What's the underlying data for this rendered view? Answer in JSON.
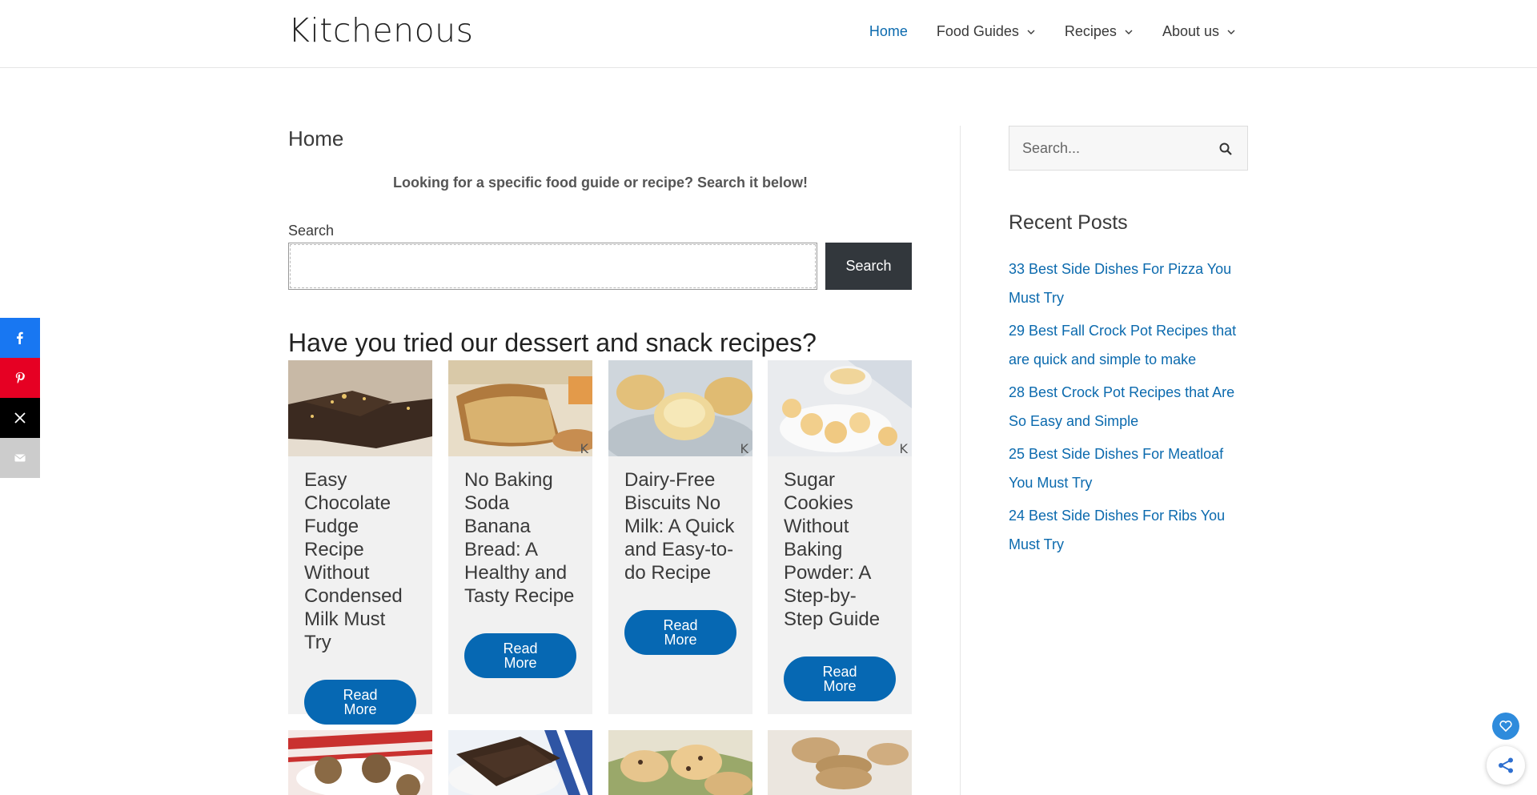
{
  "header": {
    "logo_text": "Kitchenous",
    "nav": [
      {
        "label": "Home",
        "active": true
      },
      {
        "label": "Food Guides",
        "active": false
      },
      {
        "label": "Recipes",
        "active": false
      },
      {
        "label": "About us",
        "active": false
      }
    ]
  },
  "social": [
    {
      "icon": "facebook-icon",
      "color": "#1877f2"
    },
    {
      "icon": "pinterest-icon",
      "color": "#e60023"
    },
    {
      "icon": "x-icon",
      "color": "#000000"
    },
    {
      "icon": "email-icon",
      "color": "#cccccc"
    }
  ],
  "main": {
    "page_title": "Home",
    "intro": "Looking for a specific food guide or recipe? Search it below!",
    "search": {
      "label": "Search",
      "value": "",
      "button": "Search"
    },
    "section_heading": "Have you tried our dessert and snack recipes?",
    "cards": [
      {
        "title": "Easy Chocolate Fudge Recipe Without Condensed Milk Must Try",
        "button": "Read More"
      },
      {
        "title": "No Baking Soda Banana Bread: A Healthy and Tasty Recipe",
        "button": "Read More"
      },
      {
        "title": "Dairy-Free Biscuits No Milk: A Quick and Easy-to-do Recipe",
        "button": "Read More"
      },
      {
        "title": "Sugar Cookies Without Baking Powder: A Step-by-Step Guide",
        "button": "Read More"
      }
    ],
    "image_watermark": "K"
  },
  "sidebar": {
    "search_placeholder": "Search...",
    "recent_title": "Recent Posts",
    "recent_posts": [
      "33 Best Side Dishes For Pizza You Must Try",
      "29 Best Fall Crock Pot Recipes that are quick and simple to make",
      "28 Best Crock Pot Recipes that Are So Easy and Simple",
      "25 Best Side Dishes For Meatloaf You Must Try",
      "24 Best Side Dishes For Ribs You Must Try"
    ]
  },
  "colors": {
    "accent": "#0b6aae",
    "button": "#0668b3",
    "dark_button": "#32373c"
  }
}
